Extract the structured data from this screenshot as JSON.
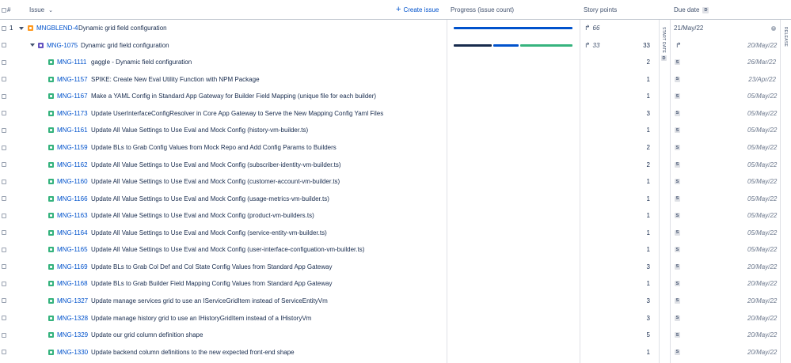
{
  "header": {
    "hash": "#",
    "issue": "Issue",
    "create_issue": "Create issue",
    "progress": "Progress (issue count)",
    "story_points": "Story points",
    "due_date": "Due date",
    "due_badge": "D"
  },
  "side_labels": {
    "start_date": "START DATE",
    "start_badge": "D",
    "release": "RELEASE"
  },
  "colors": {
    "epic_orange": "#ff991f",
    "purple": "#6554c0",
    "story_green": "#36b37e",
    "blue": "#0052cc",
    "done_dark": "#172b4d"
  },
  "rows": {
    "epic": {
      "index": "1",
      "key": "MNGBLEND-4",
      "summary": "Dynamic grid field configuration",
      "rolled_points": "66",
      "due": "21/May/22",
      "progress": [
        1.0
      ]
    },
    "parent": {
      "key": "MNG-1075",
      "summary": "Dynamic grid field configuration",
      "rolled_points": "33",
      "points": "33",
      "due": "20/May/22",
      "progress": [
        0.3,
        0.2,
        0.5
      ]
    },
    "items": [
      {
        "key": "MNG-1111",
        "summary": "gaggle - Dynamic field configuration",
        "points": "2",
        "badge": "S",
        "due": "26/Mar/22"
      },
      {
        "key": "MNG-1157",
        "summary": "SPIKE: Create New Eval Utility Function with NPM Package",
        "points": "1",
        "badge": "S",
        "due": "23/Apr/22"
      },
      {
        "key": "MNG-1167",
        "summary": "Make a YAML Config in Standard App Gateway for Builder Field Mapping (unique file for each builder)",
        "points": "1",
        "badge": "S",
        "due": "05/May/22"
      },
      {
        "key": "MNG-1173",
        "summary": "Update UserInterfaceConfigResolver in Core App Gateway to Serve the New Mapping Config Yaml Files",
        "points": "3",
        "badge": "S",
        "due": "05/May/22"
      },
      {
        "key": "MNG-1161",
        "summary": "Update All Value Settings to Use Eval and Mock Config (history-vm-builder.ts)",
        "points": "1",
        "badge": "S",
        "due": "05/May/22"
      },
      {
        "key": "MNG-1159",
        "summary": "Update BLs to Grab Config Values from Mock Repo and Add Config Params to Builders",
        "points": "2",
        "badge": "S",
        "due": "05/May/22"
      },
      {
        "key": "MNG-1162",
        "summary": "Update All Value Settings to Use Eval and Mock Config (subscriber-identity-vm-builder.ts)",
        "points": "2",
        "badge": "S",
        "due": "05/May/22"
      },
      {
        "key": "MNG-1160",
        "summary": "Update All Value Settings to Use Eval and Mock Config (customer-account-vm-builder.ts)",
        "points": "1",
        "badge": "S",
        "due": "05/May/22"
      },
      {
        "key": "MNG-1166",
        "summary": "Update All Value Settings to Use Eval and Mock Config (usage-metrics-vm-builder.ts)",
        "points": "1",
        "badge": "S",
        "due": "05/May/22"
      },
      {
        "key": "MNG-1163",
        "summary": "Update All Value Settings to Use Eval and Mock Config (product-vm-builders.ts)",
        "points": "1",
        "badge": "S",
        "due": "05/May/22"
      },
      {
        "key": "MNG-1164",
        "summary": "Update All Value Settings to Use Eval and Mock Config (service-entity-vm-builder.ts)",
        "points": "1",
        "badge": "S",
        "due": "05/May/22"
      },
      {
        "key": "MNG-1165",
        "summary": "Update All Value Settings to Use Eval and Mock Config (user-interface-configuation-vm-builder.ts)",
        "points": "1",
        "badge": "S",
        "due": "05/May/22"
      },
      {
        "key": "MNG-1169",
        "summary": "Update BLs to Grab Col Def and Col State Config Values from Standard App Gateway",
        "points": "3",
        "badge": "S",
        "due": "20/May/22"
      },
      {
        "key": "MNG-1168",
        "summary": "Update BLs to Grab Builder Field Mapping Config Values from Standard App Gateway",
        "points": "1",
        "badge": "S",
        "due": "20/May/22"
      },
      {
        "key": "MNG-1327",
        "summary": "Update manage services grid to use an IServiceGridItem instead of ServiceEntityVm",
        "points": "3",
        "badge": "S",
        "due": "20/May/22"
      },
      {
        "key": "MNG-1328",
        "summary": "Update manage history grid to use an IHistoryGridItem instead of a IHistoryVm",
        "points": "3",
        "badge": "S",
        "due": "20/May/22"
      },
      {
        "key": "MNG-1329",
        "summary": "Update our grid column definition shape",
        "points": "5",
        "badge": "S",
        "due": "20/May/22"
      },
      {
        "key": "MNG-1330",
        "summary": "Update backend column definitions to the new expected front-end shape",
        "points": "1",
        "badge": "S",
        "due": "20/May/22"
      }
    ]
  }
}
